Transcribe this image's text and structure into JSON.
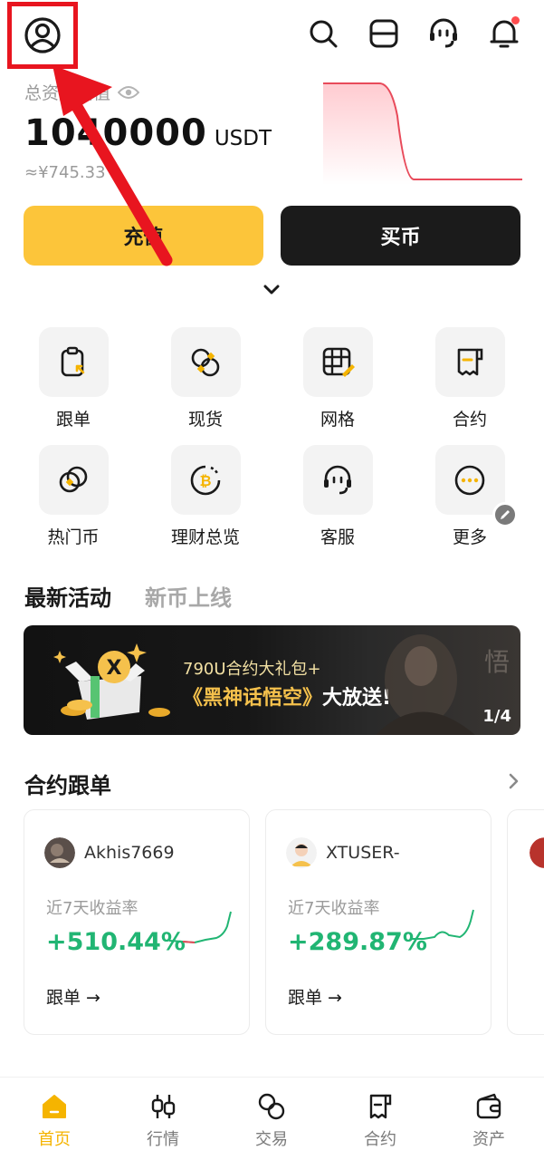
{
  "header": {
    "icons": [
      "user-icon",
      "search-icon",
      "scan-icon",
      "support-icon",
      "bell-icon"
    ]
  },
  "balance": {
    "label": "总资产估值",
    "value": "1040000",
    "unit": "USDT",
    "cny": "≈¥745.33"
  },
  "actions": {
    "deposit": "充值",
    "buy": "买币"
  },
  "grid": [
    {
      "label": "跟单",
      "icon": "copy-trade-icon"
    },
    {
      "label": "现货",
      "icon": "spot-icon"
    },
    {
      "label": "网格",
      "icon": "grid-icon"
    },
    {
      "label": "合约",
      "icon": "contract-icon"
    },
    {
      "label": "热门币",
      "icon": "hot-coin-icon"
    },
    {
      "label": "理财总览",
      "icon": "earn-icon"
    },
    {
      "label": "客服",
      "icon": "support-icon"
    },
    {
      "label": "更多",
      "icon": "more-icon"
    }
  ],
  "sections": {
    "tab_active": "最新活动",
    "tab_inactive": "新币上线"
  },
  "banner": {
    "line1": "790U合约大礼包+",
    "line2_a": "《黑神话悟空》",
    "line2_b": "大放送!",
    "page": "1/4"
  },
  "copy_trade": {
    "title": "合约跟单",
    "cards": [
      {
        "name": "Akhis7669",
        "label": "近7天收益率",
        "value": "+510.44%",
        "action": "跟单 →"
      },
      {
        "name": "XTUSER-",
        "label": "近7天收益率",
        "value": "+289.87%",
        "action": "跟单 →"
      }
    ]
  },
  "nav": [
    {
      "label": "首页",
      "icon": "home-icon",
      "active": true
    },
    {
      "label": "行情",
      "icon": "market-icon"
    },
    {
      "label": "交易",
      "icon": "trade-icon"
    },
    {
      "label": "合约",
      "icon": "contract-icon"
    },
    {
      "label": "资产",
      "icon": "wallet-icon"
    }
  ],
  "colors": {
    "accent": "#fcc53a",
    "positive": "#21b573",
    "highlight_box": "#e8151f"
  }
}
